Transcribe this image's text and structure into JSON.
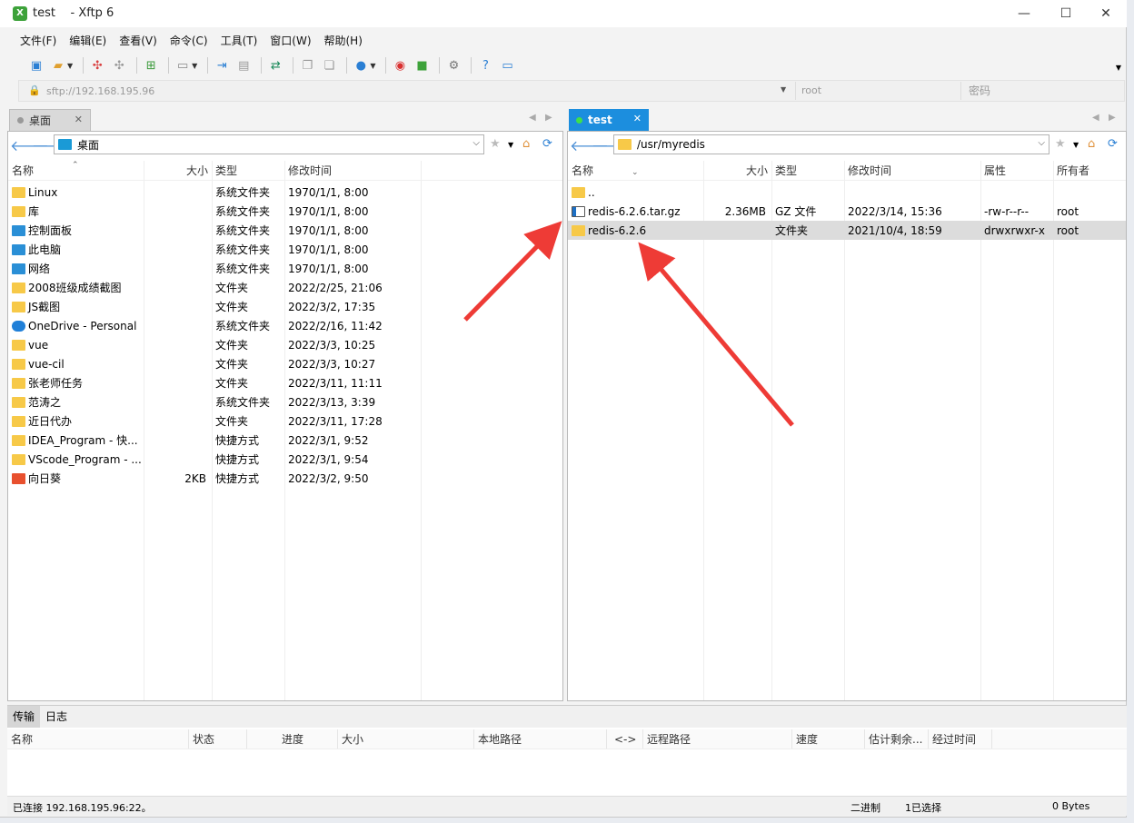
{
  "window": {
    "tab_name": "test",
    "app_title": "- Xftp 6",
    "minimize": "—",
    "maximize": "☐",
    "close": "✕"
  },
  "menu": [
    "文件(F)",
    "编辑(E)",
    "查看(V)",
    "命令(C)",
    "工具(T)",
    "窗口(W)",
    "帮助(H)"
  ],
  "address": {
    "url": "sftp://192.168.195.96",
    "user_placeholder": "root",
    "password_placeholder": "密码"
  },
  "left": {
    "tab": "桌面",
    "path": "桌面",
    "columns": [
      "名称",
      "大小",
      "类型",
      "修改时间"
    ],
    "rows": [
      {
        "name": "Linux",
        "size": "",
        "type": "系统文件夹",
        "mtime": "1970/1/1, 8:00",
        "icon": "folder-icon"
      },
      {
        "name": "库",
        "size": "",
        "type": "系统文件夹",
        "mtime": "1970/1/1, 8:00",
        "icon": "folder-icon"
      },
      {
        "name": "控制面板",
        "size": "",
        "type": "系统文件夹",
        "mtime": "1970/1/1, 8:00",
        "icon": "control-panel-icon"
      },
      {
        "name": "此电脑",
        "size": "",
        "type": "系统文件夹",
        "mtime": "1970/1/1, 8:00",
        "icon": "computer-icon"
      },
      {
        "name": "网络",
        "size": "",
        "type": "系统文件夹",
        "mtime": "1970/1/1, 8:00",
        "icon": "network-icon"
      },
      {
        "name": "2008班级成绩截图",
        "size": "",
        "type": "文件夹",
        "mtime": "2022/2/25, 21:06",
        "icon": "folder-icon"
      },
      {
        "name": "JS截图",
        "size": "",
        "type": "文件夹",
        "mtime": "2022/3/2, 17:35",
        "icon": "folder-icon"
      },
      {
        "name": "OneDrive - Personal",
        "size": "",
        "type": "系统文件夹",
        "mtime": "2022/2/16, 11:42",
        "icon": "cloud-icon"
      },
      {
        "name": "vue",
        "size": "",
        "type": "文件夹",
        "mtime": "2022/3/3, 10:25",
        "icon": "folder-icon"
      },
      {
        "name": "vue-cil",
        "size": "",
        "type": "文件夹",
        "mtime": "2022/3/3, 10:27",
        "icon": "folder-icon"
      },
      {
        "name": "张老师任务",
        "size": "",
        "type": "文件夹",
        "mtime": "2022/3/11, 11:11",
        "icon": "folder-icon"
      },
      {
        "name": "范涛之",
        "size": "",
        "type": "系统文件夹",
        "mtime": "2022/3/13, 3:39",
        "icon": "folder-icon"
      },
      {
        "name": "近日代办",
        "size": "",
        "type": "文件夹",
        "mtime": "2022/3/11, 17:28",
        "icon": "folder-icon"
      },
      {
        "name": "IDEA_Program - 快...",
        "size": "",
        "type": "快捷方式",
        "mtime": "2022/3/1, 9:52",
        "icon": "shortcut-icon"
      },
      {
        "name": "VScode_Program - ...",
        "size": "",
        "type": "快捷方式",
        "mtime": "2022/3/1, 9:54",
        "icon": "shortcut-icon"
      },
      {
        "name": "向日葵",
        "size": "2KB",
        "type": "快捷方式",
        "mtime": "2022/3/2, 9:50",
        "icon": "app-shortcut-icon"
      }
    ]
  },
  "right": {
    "tab": "test",
    "path": "/usr/myredis",
    "columns": [
      "名称",
      "大小",
      "类型",
      "修改时间",
      "属性",
      "所有者"
    ],
    "rows": [
      {
        "name": "..",
        "size": "",
        "type": "",
        "mtime": "",
        "attr": "",
        "owner": "",
        "icon": "folder-icon"
      },
      {
        "name": "redis-6.2.6.tar.gz",
        "size": "2.36MB",
        "type": "GZ 文件",
        "mtime": "2022/3/14, 15:36",
        "attr": "-rw-r--r--",
        "owner": "root",
        "icon": "archive-file-icon"
      },
      {
        "name": "redis-6.2.6",
        "size": "",
        "type": "文件夹",
        "mtime": "2021/10/4, 18:59",
        "attr": "drwxrwxr-x",
        "owner": "root",
        "icon": "folder-icon"
      }
    ]
  },
  "transfer": {
    "tabs": [
      "传输",
      "日志"
    ],
    "columns": [
      "名称",
      "状态",
      "进度",
      "大小",
      "本地路径",
      "<->",
      "远程路径",
      "速度",
      "估计剩余...",
      "经过时间"
    ]
  },
  "status": {
    "connection": "已连接 192.168.195.96:22。",
    "mode": "二进制",
    "selected": "1已选择",
    "bytes": "0 Bytes"
  },
  "colors": {
    "accent": "#1c8ede",
    "folder": "#f7c948",
    "arrow": "#ee3b36"
  }
}
